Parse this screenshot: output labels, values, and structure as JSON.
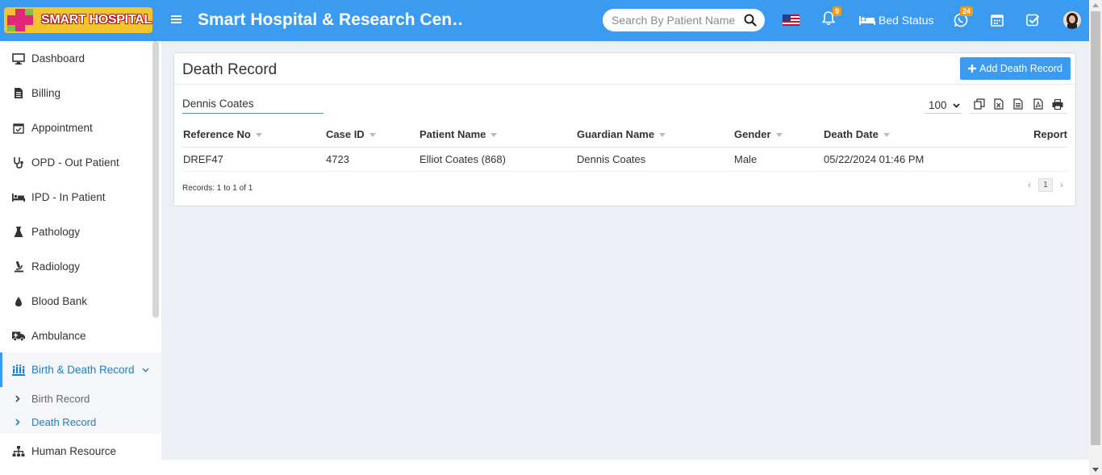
{
  "header": {
    "logo_text": "SMART HOSPITAL",
    "site_title": "Smart Hospital & Research Cen…",
    "search_placeholder": "Search By Patient Name",
    "notification_count": "9",
    "bed_status_label": "Bed Status",
    "whatsapp_count": "24",
    "colors": {
      "bar": "#3a9bf0",
      "badge": "#f39c12"
    }
  },
  "sidebar": {
    "items": [
      {
        "label": "Dashboard",
        "icon": "monitor-icon"
      },
      {
        "label": "Billing",
        "icon": "billing-icon"
      },
      {
        "label": "Appointment",
        "icon": "calendar-check-icon"
      },
      {
        "label": "OPD - Out Patient",
        "icon": "stethoscope-icon"
      },
      {
        "label": "IPD - In Patient",
        "icon": "bed-icon"
      },
      {
        "label": "Pathology",
        "icon": "flask-icon"
      },
      {
        "label": "Radiology",
        "icon": "microscope-icon"
      },
      {
        "label": "Blood Bank",
        "icon": "droplet-icon"
      },
      {
        "label": "Ambulance",
        "icon": "ambulance-icon"
      },
      {
        "label": "Birth & Death Record",
        "icon": "people-icon"
      },
      {
        "label": "Human Resource",
        "icon": "sitemap-icon"
      }
    ],
    "sub_items": [
      {
        "label": "Birth Record"
      },
      {
        "label": "Death Record"
      }
    ]
  },
  "main": {
    "title": "Death Record",
    "add_button_label": "Add Death Record",
    "filter_value": "Dennis Coates",
    "page_size": "100",
    "table": {
      "columns": [
        "Reference No",
        "Case ID",
        "Patient Name",
        "Guardian Name",
        "Gender",
        "Death Date",
        "Report"
      ],
      "rows": [
        [
          "DREF47",
          "4723",
          "Elliot Coates (868)",
          "Dennis Coates",
          "Male",
          "05/22/2024 01:46 PM",
          ""
        ]
      ]
    },
    "records_info": "Records: 1 to 1 of 1",
    "current_page": "1"
  }
}
